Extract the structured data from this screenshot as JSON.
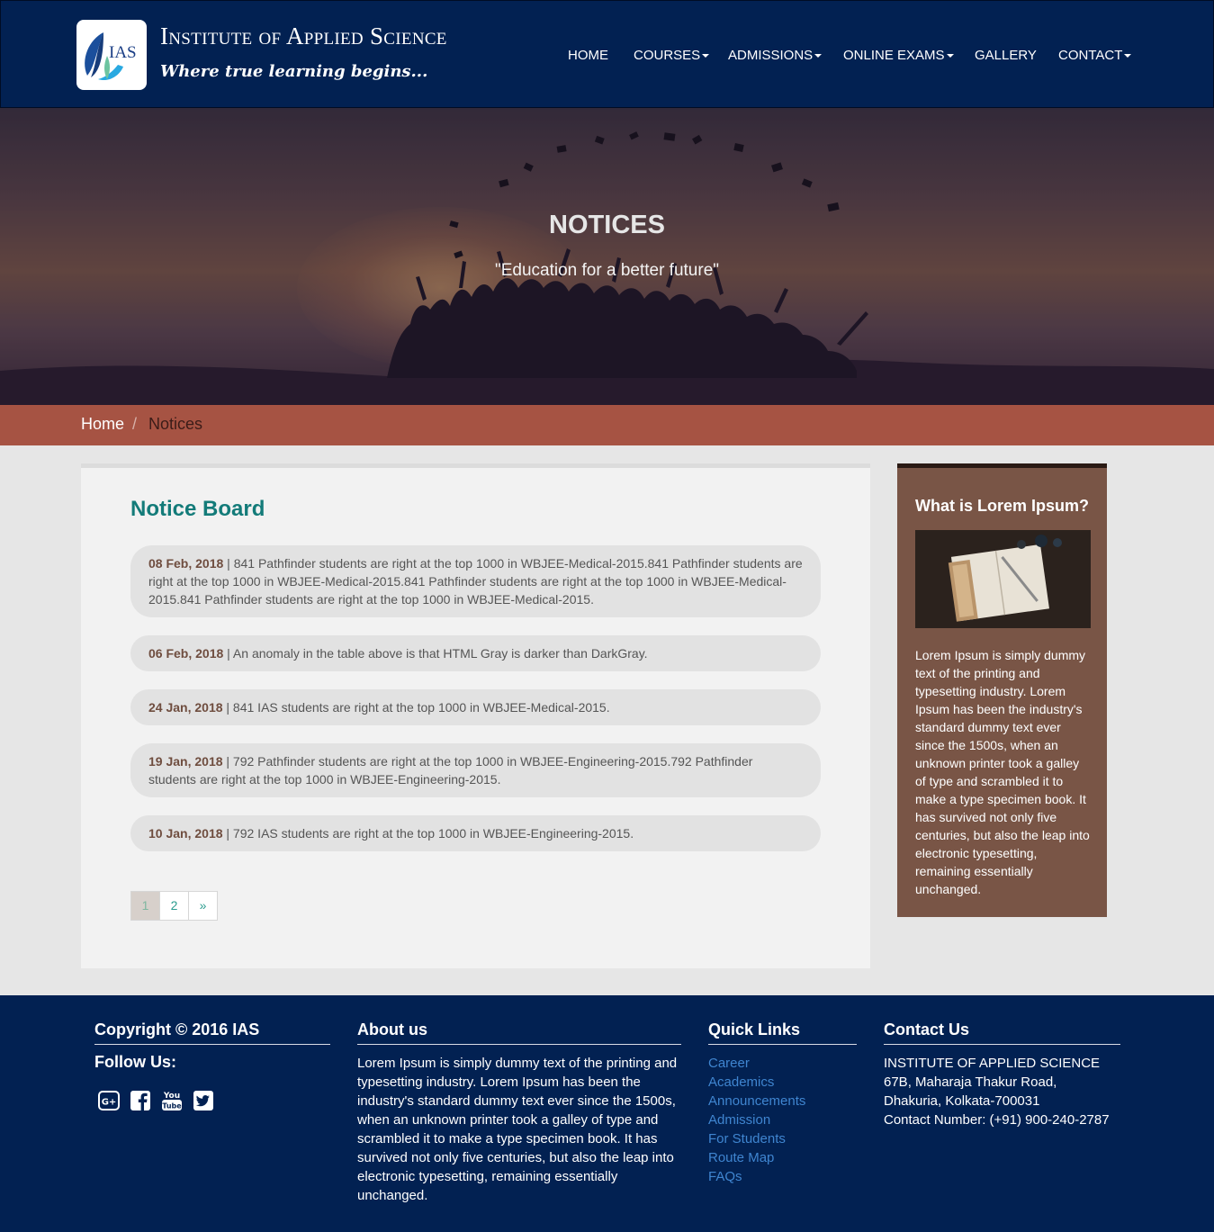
{
  "header": {
    "title": "Institute of Applied Science",
    "tagline": "Where true learning begins...",
    "logo_text": "IAS"
  },
  "nav": {
    "items": [
      {
        "label": "HOME",
        "dropdown": false
      },
      {
        "label": "COURSES",
        "dropdown": true
      },
      {
        "label": "ADMISSIONS",
        "dropdown": true
      },
      {
        "label": "ONLINE EXAMS",
        "dropdown": true
      },
      {
        "label": "GALLERY",
        "dropdown": false
      },
      {
        "label": "CONTACT",
        "dropdown": true
      }
    ]
  },
  "hero": {
    "title": "NOTICES",
    "subtitle": "\"Education for a better future\""
  },
  "breadcrumb": {
    "home": "Home",
    "separator": "/",
    "current": "Notices"
  },
  "notice_board": {
    "title": "Notice Board",
    "notices": [
      {
        "date": "08 Feb, 2018",
        "text": " | 841 Pathfinder students are right at the top 1000 in WBJEE-Medical-2015.841 Pathfinder students are right at the top 1000 in WBJEE-Medical-2015.841 Pathfinder students are right at the top 1000 in WBJEE-Medical-2015.841 Pathfinder students are right at the top 1000 in WBJEE-Medical-2015."
      },
      {
        "date": "06 Feb, 2018",
        "text": " | An anomaly in the table above is that HTML Gray is darker than DarkGray."
      },
      {
        "date": "24 Jan, 2018",
        "text": " | 841 IAS students are right at the top 1000 in WBJEE-Medical-2015."
      },
      {
        "date": "19 Jan, 2018",
        "text": " | 792 Pathfinder students are right at the top 1000 in WBJEE-Engineering-2015.792 Pathfinder students are right at the top 1000 in WBJEE-Engineering-2015."
      },
      {
        "date": "10 Jan, 2018",
        "text": " | 792 IAS students are right at the top 1000 in WBJEE-Engineering-2015."
      }
    ],
    "pagination": {
      "pages": [
        "1",
        "2"
      ],
      "next": "»",
      "current": "1"
    }
  },
  "sidebar": {
    "title": "What is Lorem Ipsum?",
    "text": "Lorem Ipsum is simply dummy text of the printing and typesetting industry. Lorem Ipsum has been the industry's standard dummy text ever since the 1500s, when an unknown printer took a galley of type and scrambled it to make a type specimen book. It has survived not only five centuries, but also the leap into electronic typesetting, remaining essentially unchanged."
  },
  "footer": {
    "copyright": "Copyright © 2016 IAS",
    "follow": "Follow Us:",
    "social": [
      "google-plus-icon",
      "facebook-icon",
      "youtube-icon",
      "twitter-icon"
    ],
    "about_title": "About us",
    "about_text": "Lorem Ipsum is simply dummy text of the printing and typesetting industry. Lorem Ipsum has been the industry's standard dummy text ever since the 1500s, when an unknown printer took a galley of type and scrambled it to make a type specimen book. It has survived not only five centuries, but also the leap into electronic typesetting, remaining essentially unchanged.",
    "quick_links_title": "Quick Links",
    "quick_links": [
      "Career",
      "Academics",
      "Announcements",
      "Admission",
      "For Students",
      "Route Map",
      "FAQs"
    ],
    "contact_title": "Contact Us",
    "contact_lines": [
      "INSTITUTE OF APPLIED SCIENCE",
      "67B, Maharaja Thakur Road,",
      "Dhakuria, Kolkata-700031",
      "Contact Number: (+91) 900-240-2787"
    ]
  },
  "colors": {
    "navy": "#022152",
    "breadcrumb": "#a65343",
    "sidebar": "#795546",
    "accent_teal": "#137b79",
    "link_blue": "#3f85d0"
  }
}
